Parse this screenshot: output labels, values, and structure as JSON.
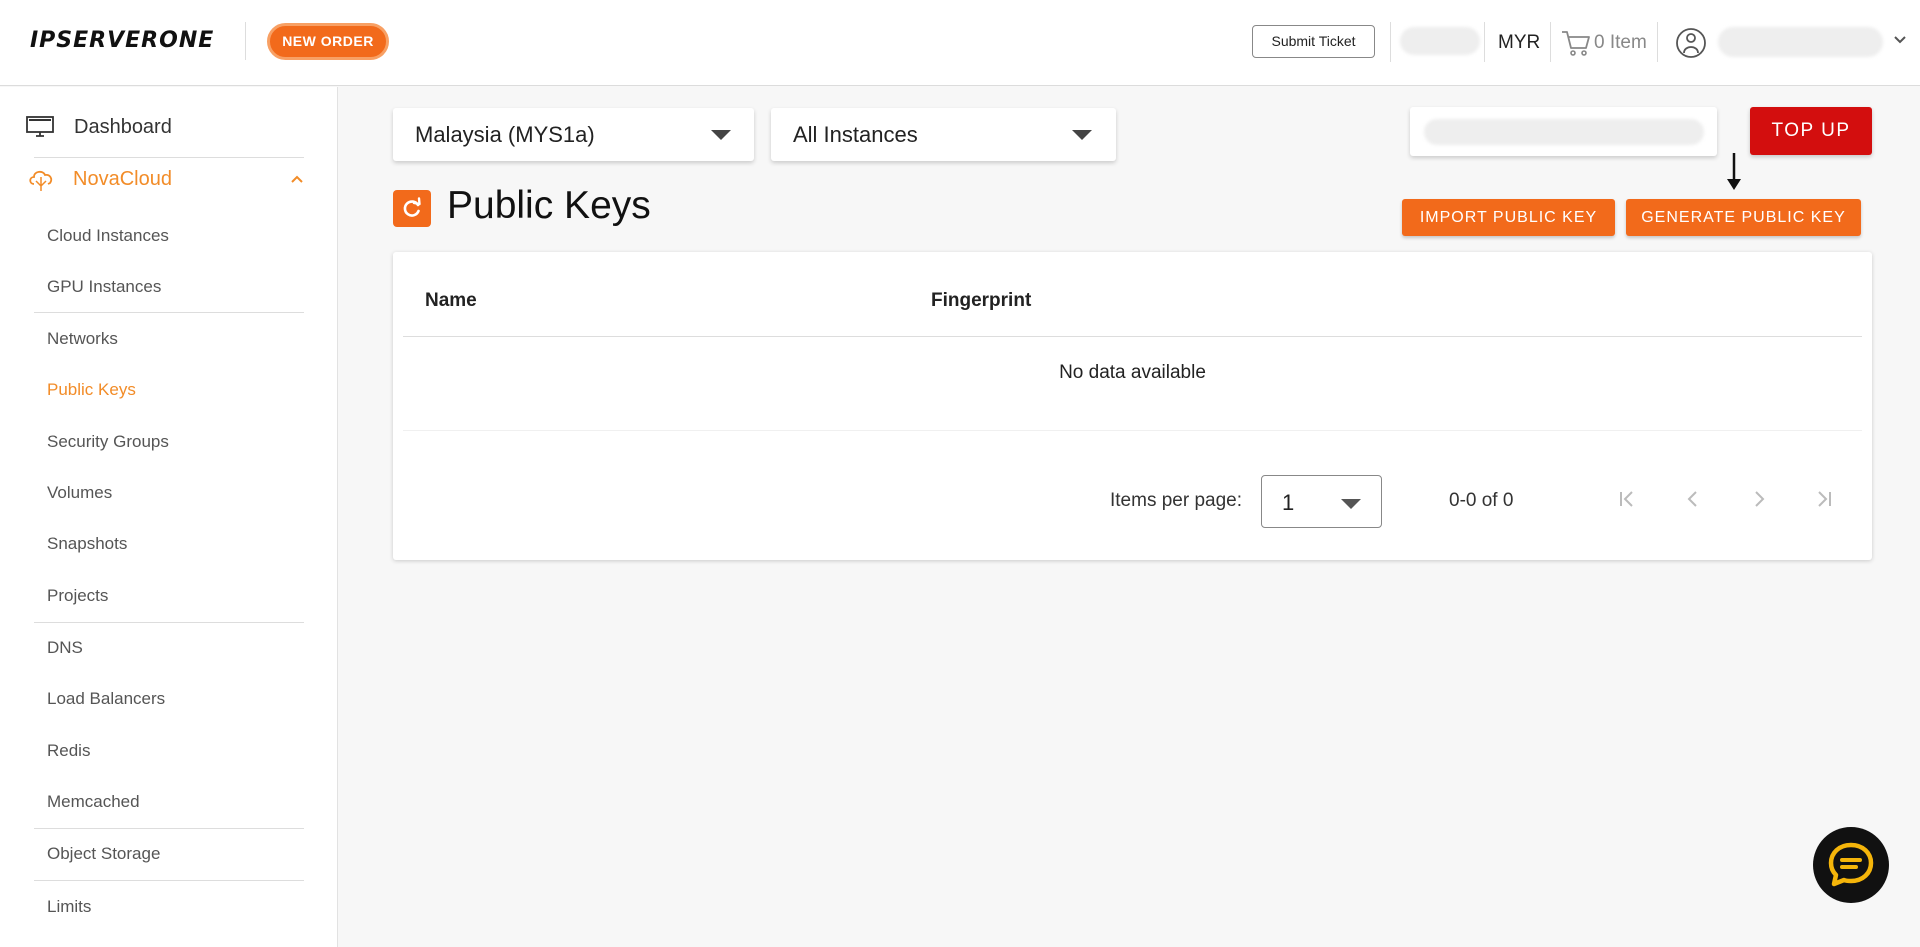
{
  "header": {
    "logo_text": "IPSERVERONE",
    "new_order_label": "NEW ORDER",
    "submit_ticket_label": "Submit Ticket",
    "currency": "MYR",
    "cart_label": "0 Item"
  },
  "sidebar": {
    "dashboard_label": "Dashboard",
    "section_label": "NovaCloud",
    "items": [
      {
        "label": "Cloud Instances"
      },
      {
        "label": "GPU Instances"
      },
      {
        "label": "Networks"
      },
      {
        "label": "Public Keys",
        "active": true
      },
      {
        "label": "Security Groups"
      },
      {
        "label": "Volumes"
      },
      {
        "label": "Snapshots"
      },
      {
        "label": "Projects"
      },
      {
        "label": "DNS"
      },
      {
        "label": "Load Balancers"
      },
      {
        "label": "Redis"
      },
      {
        "label": "Memcached"
      },
      {
        "label": "Object Storage"
      },
      {
        "label": "Limits"
      }
    ]
  },
  "filters": {
    "region": "Malaysia (MYS1a)",
    "instances": "All Instances"
  },
  "topup_label": "TOP UP",
  "page": {
    "title": "Public Keys",
    "import_label": "IMPORT PUBLIC KEY",
    "generate_label": "GENERATE PUBLIC KEY"
  },
  "table": {
    "columns": [
      "Name",
      "Fingerprint"
    ],
    "empty_text": "No data available",
    "items_per_page_label": "Items per page:",
    "items_per_page_value": "1",
    "range_text": "0-0 of 0"
  },
  "colors": {
    "accent": "#f26a1b",
    "active_nav": "#f28c28",
    "topup": "#d30e0e"
  }
}
